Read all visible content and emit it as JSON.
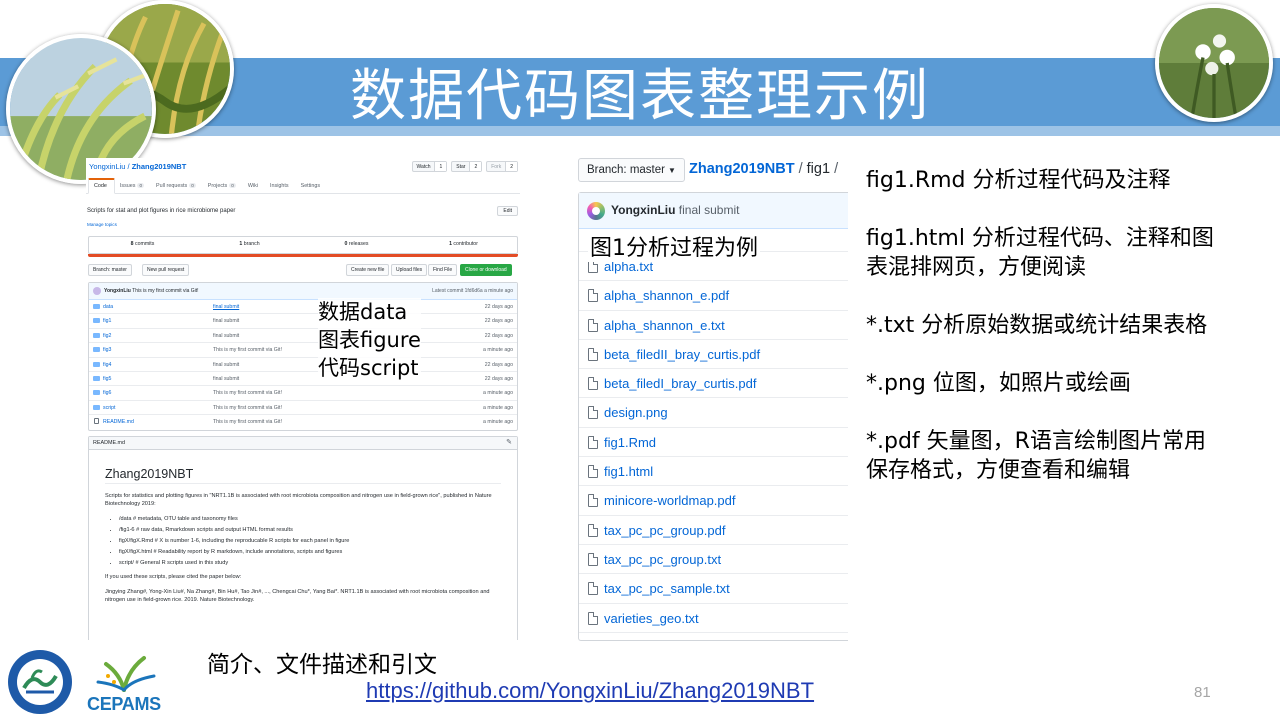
{
  "slide": {
    "title": "数据代码图表整理示例",
    "page_number": "81",
    "accent": "#5b9bd5"
  },
  "github": {
    "owner": "YongxinLiu",
    "repo": "Zhang2019NBT",
    "watch": {
      "label": "Watch",
      "count": "1"
    },
    "star": {
      "label": "Star",
      "count": "2"
    },
    "fork": {
      "label": "Fork",
      "count": "2"
    },
    "tabs": [
      {
        "label": "Code",
        "count": ""
      },
      {
        "label": "Issues",
        "count": "0"
      },
      {
        "label": "Pull requests",
        "count": "0"
      },
      {
        "label": "Projects",
        "count": "0"
      },
      {
        "label": "Wiki",
        "count": ""
      },
      {
        "label": "Insights",
        "count": ""
      },
      {
        "label": "Settings",
        "count": ""
      }
    ],
    "description": "Scripts for stat and plot figures in rice microbiome paper",
    "edit_label": "Edit",
    "manage_topics": "Manage topics",
    "stats": {
      "commits": {
        "num": "8",
        "label": "commits"
      },
      "branches": {
        "num": "1",
        "label": "branch"
      },
      "releases": {
        "num": "0",
        "label": "releases"
      },
      "contributors": {
        "num": "1",
        "label": "contributor"
      }
    },
    "branch_label": "Branch: master",
    "new_pr": "New pull request",
    "create_file": "Create new file",
    "upload": "Upload files",
    "find": "Find File",
    "clone": "Clone or download",
    "last_commit": {
      "author": "YongxinLiu",
      "message": "This is my first commit via Git!",
      "latest": "Latest commit 1fd6d6a a minute ago"
    },
    "files": [
      {
        "name": "data",
        "msg": "final submit",
        "age": "22 days ago",
        "link": true
      },
      {
        "name": "fig1",
        "msg": "final submit",
        "age": "22 days ago",
        "link": false
      },
      {
        "name": "fig2",
        "msg": "final submit",
        "age": "22 days ago",
        "link": false
      },
      {
        "name": "fig3",
        "msg": "This is my first commit via Git!",
        "age": "a minute ago",
        "link": false
      },
      {
        "name": "fig4",
        "msg": "final submit",
        "age": "22 days ago",
        "link": false
      },
      {
        "name": "fig5",
        "msg": "final submit",
        "age": "22 days ago",
        "link": false
      },
      {
        "name": "fig6",
        "msg": "This is my first commit via Git!",
        "age": "a minute ago",
        "link": false
      },
      {
        "name": "script",
        "msg": "This is my first commit via Git!",
        "age": "a minute ago",
        "link": false
      },
      {
        "name": "README.md",
        "msg": "This is my first commit via Git!",
        "age": "a minute ago",
        "link": false
      }
    ],
    "readme": {
      "file": "README.md",
      "title": "Zhang2019NBT",
      "intro": "Scripts for statistics and plotting figures in \"NRT1.1B is associated with root microbiota composition and nitrogen use in field-grown rice\", published in Nature Biotechnology 2019:",
      "bullets": [
        "/data # metadata, OTU table and taxonomy files",
        "/fig1-6 # raw data, Rmarkdown scripts and output HTML format results",
        "figX/figX.Rmd # X is number 1-6, including the reproducable R scripts for each panel in figure",
        "figX/figX.html # Readability report by R markdown, include annotations, scripts and figures",
        "script/ # General R scripts used in this study"
      ],
      "cite_intro": "If you used these scripts, please cited the paper below:",
      "citation": "Jingying Zhang#, Yong-Xin Liu#, Na Zhang#, Bin Hu#, Tao Jin#, ..., Chengcai Chu*, Yang Bai*. NRT1.1B is associated with root microbiota composition and nitrogen use in field-grown rice. 2019. Nature Biotechnology."
    }
  },
  "filelist": {
    "branch": "Branch: master",
    "repo": "Zhang2019NBT",
    "path": "fig1",
    "commit_author": "YongxinLiu",
    "commit_msg": "final submit",
    "files": [
      "alpha.txt",
      "alpha_shannon_e.pdf",
      "alpha_shannon_e.txt",
      "beta_filedII_bray_curtis.pdf",
      "beta_filedI_bray_curtis.pdf",
      "design.png",
      "fig1.Rmd",
      "fig1.html",
      "minicore-worldmap.pdf",
      "tax_pc_pc_group.pdf",
      "tax_pc_pc_group.txt",
      "tax_pc_pc_sample.txt",
      "varieties_geo.txt"
    ]
  },
  "annotations": {
    "fig1_example": "图1分析过程为例",
    "types": [
      "数据data",
      "图表figure",
      "代码script"
    ],
    "caption": "简介、文件描述和引文",
    "url": "https://github.com/YongxinLiu/Zhang2019NBT"
  },
  "notes": [
    "fig1.Rmd 分析过程代码及注释",
    "fig1.html 分析过程代码、注释和图表混排网页，方便阅读",
    "*.txt 分析原始数据或统计结果表格",
    "*.png 位图，如照片或绘画",
    "*.pdf 矢量图，R语言绘制图片常用保存格式，方便查看和编辑"
  ],
  "logos": {
    "cepams_text": "CEPAMS"
  }
}
